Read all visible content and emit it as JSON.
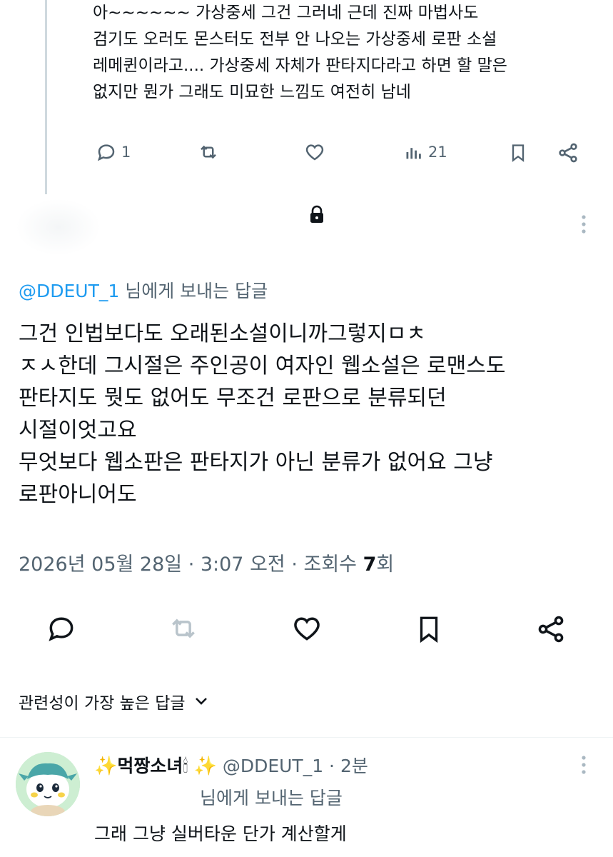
{
  "previous_tweet": {
    "lines": [
      "아~~~~~~ 가상중세 그건 그러네 근데 진짜 마법사도",
      "검기도 오러도 몬스터도 전부 안 나오는 가상중세 로판 소설",
      "레메퀸이라고.... 가상중세 자체가 판타지다라고 하면 할 말은",
      "없지만 뭔가 그래도 미묘한 느낌도 여전히 남네"
    ],
    "reply_count": "1",
    "view_count": "21"
  },
  "main_tweet": {
    "reply_to_handle": "@DDEUT_1",
    "reply_to_suffix": " 님에게 보내는 답글",
    "lines": [
      "그건 인법보다도 오래된소설이니까그렇지ㅁㅊ",
      "ㅈㅅ한데 그시절은 주인공이 여자인 웹소설은 로맨스도",
      "판타지도 뭣도 없어도 무조건 로판으로 분류되던",
      "시절이엇고요",
      "무엇보다 웹소판은 판타지가 아닌 분류가 없어요 그냥",
      "로판아니어도"
    ],
    "meta_date": "2026년 05월 28일 · 3:07 오전 · 조회수 ",
    "meta_views": "7",
    "meta_views_suffix": "회"
  },
  "sort": {
    "label": "관련성이 가장 높은 답글",
    "icon": "chevron-down-icon"
  },
  "reply": {
    "sparkle_left": "✨",
    "display_name": "먹짱소녀",
    "candle": "🕯",
    "sparkle_right": "✨",
    "handle_time": "@DDEUT_1 · 2분",
    "reply_to_label": "님에게 보내는 답글",
    "text": "그래 그냥 실버타운 단가 계산할게"
  },
  "colors": {
    "accent": "#1d9bf0",
    "muted": "#536471",
    "text": "#0f1419",
    "border": "#eff3f4"
  }
}
